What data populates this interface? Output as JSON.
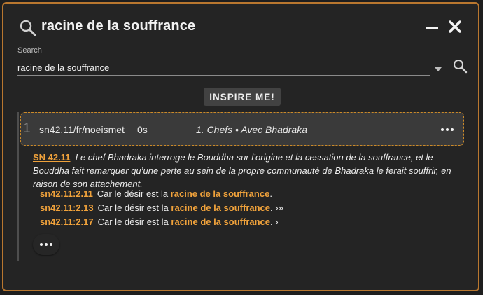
{
  "header": {
    "title": "racine de la souffrance",
    "search_icon": "search-icon",
    "minimize_icon": "minimize-icon",
    "close_icon": "close-icon"
  },
  "search": {
    "label": "Search",
    "value": "racine de la souffrance",
    "dropdown_icon": "caret-down-icon",
    "button_icon": "search-icon"
  },
  "inspire_button": "INSPIRE ME!",
  "result": {
    "index": "1",
    "id": "sn42.11/fr/noeismet",
    "time": "0s",
    "title": "1. Chefs • Avec Bhadraka",
    "menu_icon": "more-horizontal-icon"
  },
  "sutta": {
    "ref": "SN 42.11",
    "summary": "Le chef Bhadraka interroge le Bouddha sur l’origine et la cessation de la souffrance, et le Bouddha fait remarquer qu’une perte au sein de la propre communauté de Bhadraka le ferait souffrir, en raison de son attachement."
  },
  "matches": [
    {
      "ref": "sn42.11:2.11",
      "before": "Car le désir est la",
      "highlight": "racine de la souffrance",
      "after": "."
    },
    {
      "ref": "sn42.11:2.13",
      "before": "Car le désir est la",
      "highlight": "racine de la souffrance",
      "after": ". ›»"
    },
    {
      "ref": "sn42.11:2.17",
      "before": "Car le désir est la",
      "highlight": "racine de la souffrance",
      "after": ". ›"
    }
  ],
  "more_button_icon": "more-horizontal-icon",
  "colors": {
    "accent": "#f0a23b",
    "frame_border": "#b9772f",
    "background": "#242424",
    "card": "#3a3a3a"
  }
}
